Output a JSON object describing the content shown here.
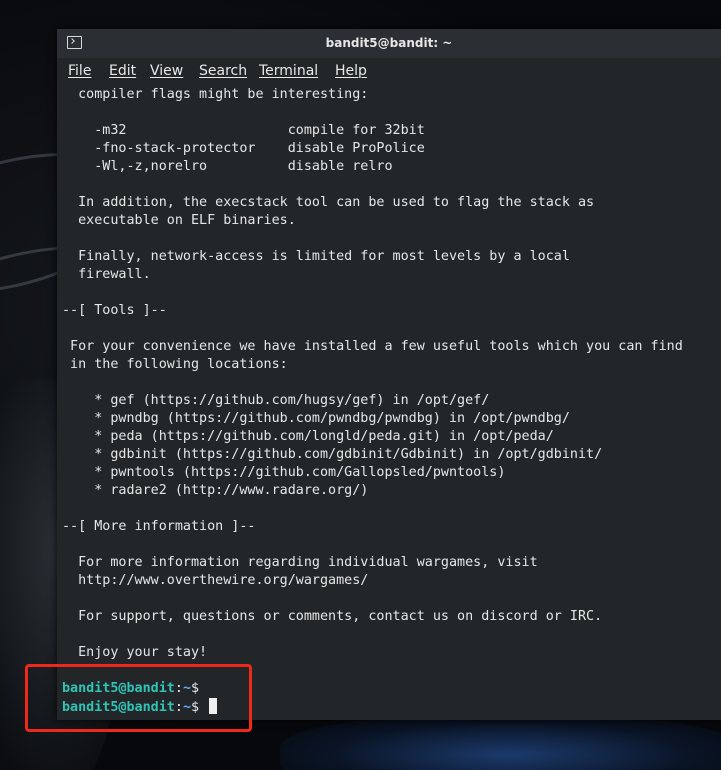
{
  "window": {
    "title": "bandit5@bandit: ~"
  },
  "menu": [
    "File",
    "Edit",
    "View",
    "Search",
    "Terminal",
    "Help"
  ],
  "terminal_lines": [
    "  compiler flags might be interesting:",
    "",
    "    -m32                    compile for 32bit",
    "    -fno-stack-protector    disable ProPolice",
    "    -Wl,-z,norelro          disable relro",
    "",
    "  In addition, the execstack tool can be used to flag the stack as",
    "  executable on ELF binaries.",
    "",
    "  Finally, network-access is limited for most levels by a local",
    "  firewall.",
    "",
    "--[ Tools ]--",
    "",
    " For your convenience we have installed a few useful tools which you can find",
    " in the following locations:",
    "",
    "    * gef (https://github.com/hugsy/gef) in /opt/gef/",
    "    * pwndbg (https://github.com/pwndbg/pwndbg) in /opt/pwndbg/",
    "    * peda (https://github.com/longld/peda.git) in /opt/peda/",
    "    * gdbinit (https://github.com/gdbinit/Gdbinit) in /opt/gdbinit/",
    "    * pwntools (https://github.com/Gallopsled/pwntools)",
    "    * radare2 (http://www.radare.org/)",
    "",
    "--[ More information ]--",
    "",
    "  For more information regarding individual wargames, visit",
    "  http://www.overthewire.org/wargames/",
    "",
    "  For support, questions or comments, contact us on discord or IRC.",
    "",
    "  Enjoy your stay!",
    ""
  ],
  "prompt": {
    "user_host": "bandit5@bandit",
    "separator": ":",
    "path": "~",
    "symbol": "$"
  },
  "colors": {
    "highlight": "#f0281a",
    "prompt_user": "#2ec4b6",
    "prompt_path": "#5fa8ff"
  }
}
